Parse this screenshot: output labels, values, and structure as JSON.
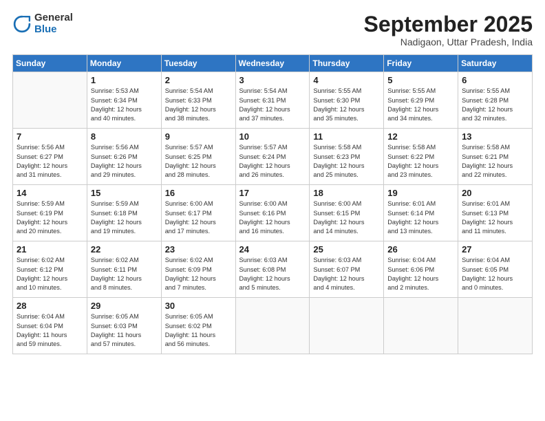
{
  "header": {
    "logo_general": "General",
    "logo_blue": "Blue",
    "month": "September 2025",
    "location": "Nadigaon, Uttar Pradesh, India"
  },
  "days_of_week": [
    "Sunday",
    "Monday",
    "Tuesday",
    "Wednesday",
    "Thursday",
    "Friday",
    "Saturday"
  ],
  "weeks": [
    [
      {
        "day": "",
        "info": ""
      },
      {
        "day": "1",
        "info": "Sunrise: 5:53 AM\nSunset: 6:34 PM\nDaylight: 12 hours\nand 40 minutes."
      },
      {
        "day": "2",
        "info": "Sunrise: 5:54 AM\nSunset: 6:33 PM\nDaylight: 12 hours\nand 38 minutes."
      },
      {
        "day": "3",
        "info": "Sunrise: 5:54 AM\nSunset: 6:31 PM\nDaylight: 12 hours\nand 37 minutes."
      },
      {
        "day": "4",
        "info": "Sunrise: 5:55 AM\nSunset: 6:30 PM\nDaylight: 12 hours\nand 35 minutes."
      },
      {
        "day": "5",
        "info": "Sunrise: 5:55 AM\nSunset: 6:29 PM\nDaylight: 12 hours\nand 34 minutes."
      },
      {
        "day": "6",
        "info": "Sunrise: 5:55 AM\nSunset: 6:28 PM\nDaylight: 12 hours\nand 32 minutes."
      }
    ],
    [
      {
        "day": "7",
        "info": "Sunrise: 5:56 AM\nSunset: 6:27 PM\nDaylight: 12 hours\nand 31 minutes."
      },
      {
        "day": "8",
        "info": "Sunrise: 5:56 AM\nSunset: 6:26 PM\nDaylight: 12 hours\nand 29 minutes."
      },
      {
        "day": "9",
        "info": "Sunrise: 5:57 AM\nSunset: 6:25 PM\nDaylight: 12 hours\nand 28 minutes."
      },
      {
        "day": "10",
        "info": "Sunrise: 5:57 AM\nSunset: 6:24 PM\nDaylight: 12 hours\nand 26 minutes."
      },
      {
        "day": "11",
        "info": "Sunrise: 5:58 AM\nSunset: 6:23 PM\nDaylight: 12 hours\nand 25 minutes."
      },
      {
        "day": "12",
        "info": "Sunrise: 5:58 AM\nSunset: 6:22 PM\nDaylight: 12 hours\nand 23 minutes."
      },
      {
        "day": "13",
        "info": "Sunrise: 5:58 AM\nSunset: 6:21 PM\nDaylight: 12 hours\nand 22 minutes."
      }
    ],
    [
      {
        "day": "14",
        "info": "Sunrise: 5:59 AM\nSunset: 6:19 PM\nDaylight: 12 hours\nand 20 minutes."
      },
      {
        "day": "15",
        "info": "Sunrise: 5:59 AM\nSunset: 6:18 PM\nDaylight: 12 hours\nand 19 minutes."
      },
      {
        "day": "16",
        "info": "Sunrise: 6:00 AM\nSunset: 6:17 PM\nDaylight: 12 hours\nand 17 minutes."
      },
      {
        "day": "17",
        "info": "Sunrise: 6:00 AM\nSunset: 6:16 PM\nDaylight: 12 hours\nand 16 minutes."
      },
      {
        "day": "18",
        "info": "Sunrise: 6:00 AM\nSunset: 6:15 PM\nDaylight: 12 hours\nand 14 minutes."
      },
      {
        "day": "19",
        "info": "Sunrise: 6:01 AM\nSunset: 6:14 PM\nDaylight: 12 hours\nand 13 minutes."
      },
      {
        "day": "20",
        "info": "Sunrise: 6:01 AM\nSunset: 6:13 PM\nDaylight: 12 hours\nand 11 minutes."
      }
    ],
    [
      {
        "day": "21",
        "info": "Sunrise: 6:02 AM\nSunset: 6:12 PM\nDaylight: 12 hours\nand 10 minutes."
      },
      {
        "day": "22",
        "info": "Sunrise: 6:02 AM\nSunset: 6:11 PM\nDaylight: 12 hours\nand 8 minutes."
      },
      {
        "day": "23",
        "info": "Sunrise: 6:02 AM\nSunset: 6:09 PM\nDaylight: 12 hours\nand 7 minutes."
      },
      {
        "day": "24",
        "info": "Sunrise: 6:03 AM\nSunset: 6:08 PM\nDaylight: 12 hours\nand 5 minutes."
      },
      {
        "day": "25",
        "info": "Sunrise: 6:03 AM\nSunset: 6:07 PM\nDaylight: 12 hours\nand 4 minutes."
      },
      {
        "day": "26",
        "info": "Sunrise: 6:04 AM\nSunset: 6:06 PM\nDaylight: 12 hours\nand 2 minutes."
      },
      {
        "day": "27",
        "info": "Sunrise: 6:04 AM\nSunset: 6:05 PM\nDaylight: 12 hours\nand 0 minutes."
      }
    ],
    [
      {
        "day": "28",
        "info": "Sunrise: 6:04 AM\nSunset: 6:04 PM\nDaylight: 11 hours\nand 59 minutes."
      },
      {
        "day": "29",
        "info": "Sunrise: 6:05 AM\nSunset: 6:03 PM\nDaylight: 11 hours\nand 57 minutes."
      },
      {
        "day": "30",
        "info": "Sunrise: 6:05 AM\nSunset: 6:02 PM\nDaylight: 11 hours\nand 56 minutes."
      },
      {
        "day": "",
        "info": ""
      },
      {
        "day": "",
        "info": ""
      },
      {
        "day": "",
        "info": ""
      },
      {
        "day": "",
        "info": ""
      }
    ]
  ]
}
